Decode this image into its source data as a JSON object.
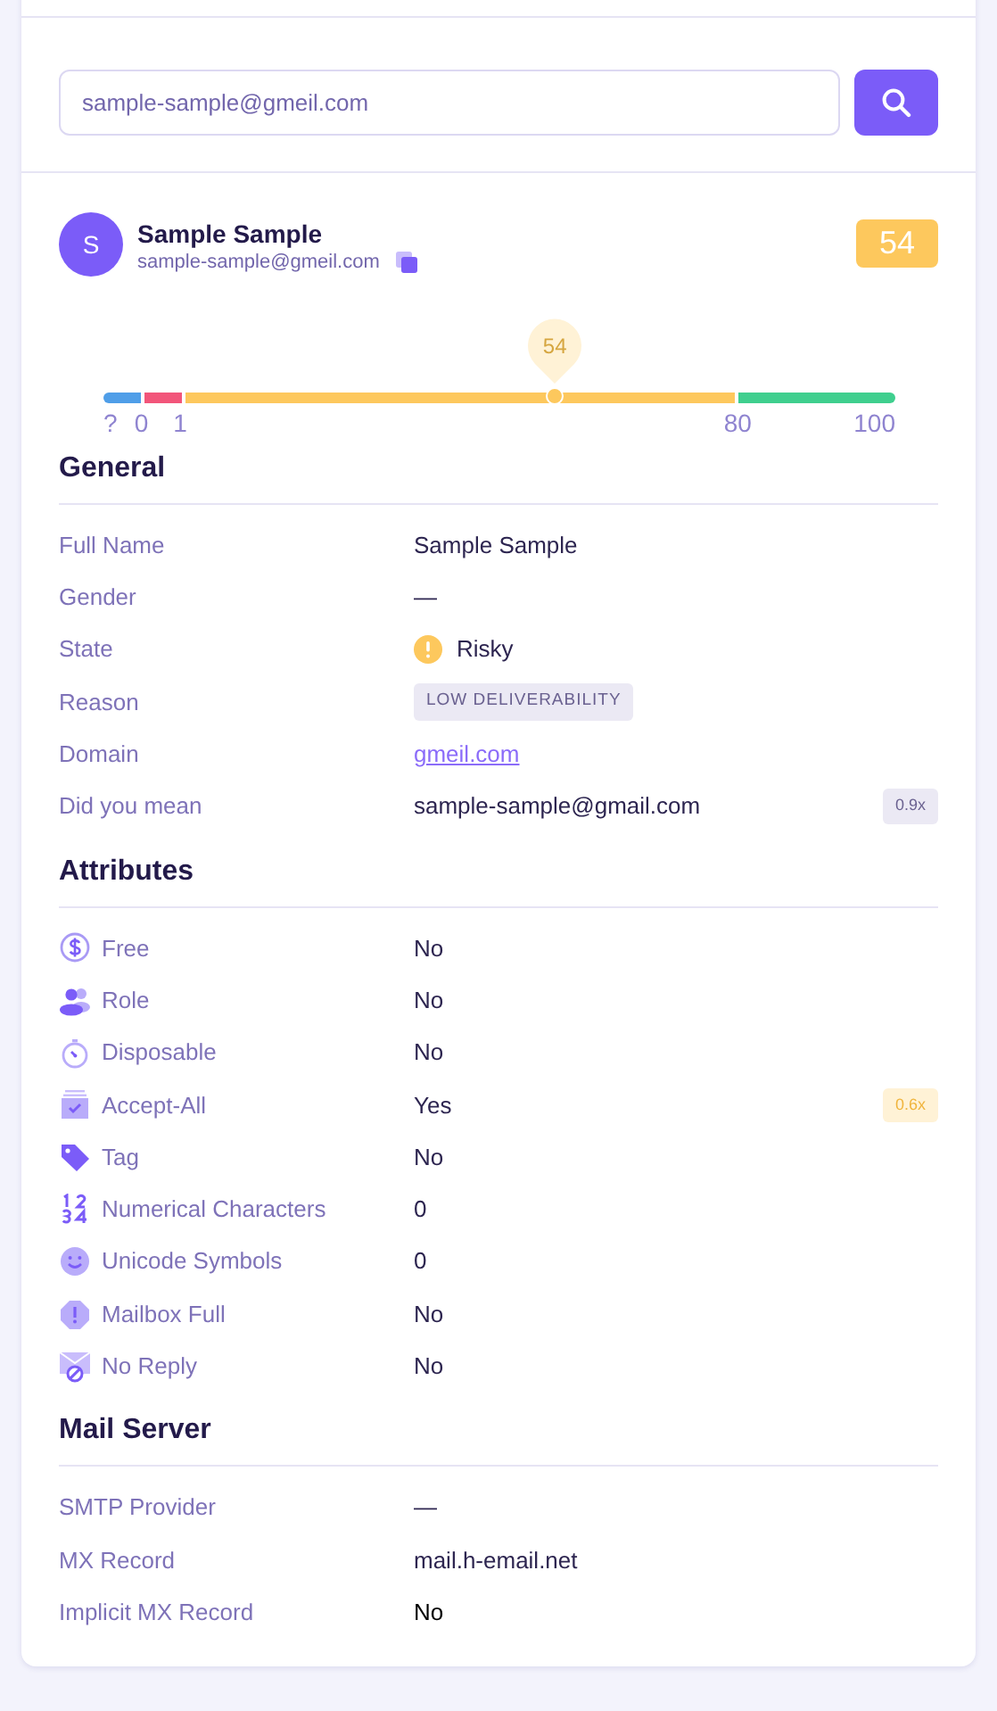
{
  "search": {
    "value": "sample-sample@gmeil.com"
  },
  "profile": {
    "initial": "S",
    "name": "Sample Sample",
    "email": "sample-sample@gmeil.com",
    "score": "54"
  },
  "score_scale": {
    "marker": "54",
    "ticks": [
      "?",
      "0",
      "1",
      "80",
      "100"
    ]
  },
  "sections": [
    {
      "title": "General",
      "rows": [
        {
          "label": "Full Name",
          "kind": "text",
          "value": "Sample Sample"
        },
        {
          "label": "Gender",
          "kind": "text",
          "value": "—"
        },
        {
          "label": "State",
          "kind": "state",
          "value": "Risky"
        },
        {
          "label": "Reason",
          "kind": "tag",
          "value": "LOW DELIVERABILITY"
        },
        {
          "label": "Domain",
          "kind": "link",
          "value": "gmeil.com"
        },
        {
          "label": "Did you mean",
          "kind": "text",
          "value": "sample-sample@gmail.com",
          "badge": {
            "text": "0.9x",
            "color": "#ebe9f4"
          }
        }
      ]
    },
    {
      "title": "Attributes",
      "rows": [
        {
          "label": "Free",
          "kind": "attribute",
          "value": "No"
        },
        {
          "label": "Role",
          "kind": "attribute",
          "value": "No"
        },
        {
          "label": "Disposable",
          "kind": "attribute",
          "value": "No"
        },
        {
          "label": "Accept-All",
          "kind": "attribute",
          "value": "Yes",
          "badge": {
            "text": "0.6x",
            "color": "#fff2d6"
          }
        },
        {
          "label": "Tag",
          "kind": "attribute",
          "value": "No"
        },
        {
          "label": "Numerical Characters",
          "kind": "attribute",
          "value": "0"
        },
        {
          "label": "Unicode Symbols",
          "kind": "attribute",
          "value": "0"
        },
        {
          "label": "Mailbox Full",
          "kind": "attribute",
          "value": "No"
        },
        {
          "label": "No Reply",
          "kind": "attribute",
          "value": "No"
        }
      ]
    },
    {
      "title": "Mail Server",
      "rows": [
        {
          "label": "SMTP Provider",
          "kind": "text",
          "value": "—"
        },
        {
          "label": "MX Record",
          "kind": "text",
          "value": "mail.h-email.net"
        },
        {
          "label": "Implicit MX Record",
          "kind": "plain",
          "value": "No"
        }
      ]
    }
  ]
}
